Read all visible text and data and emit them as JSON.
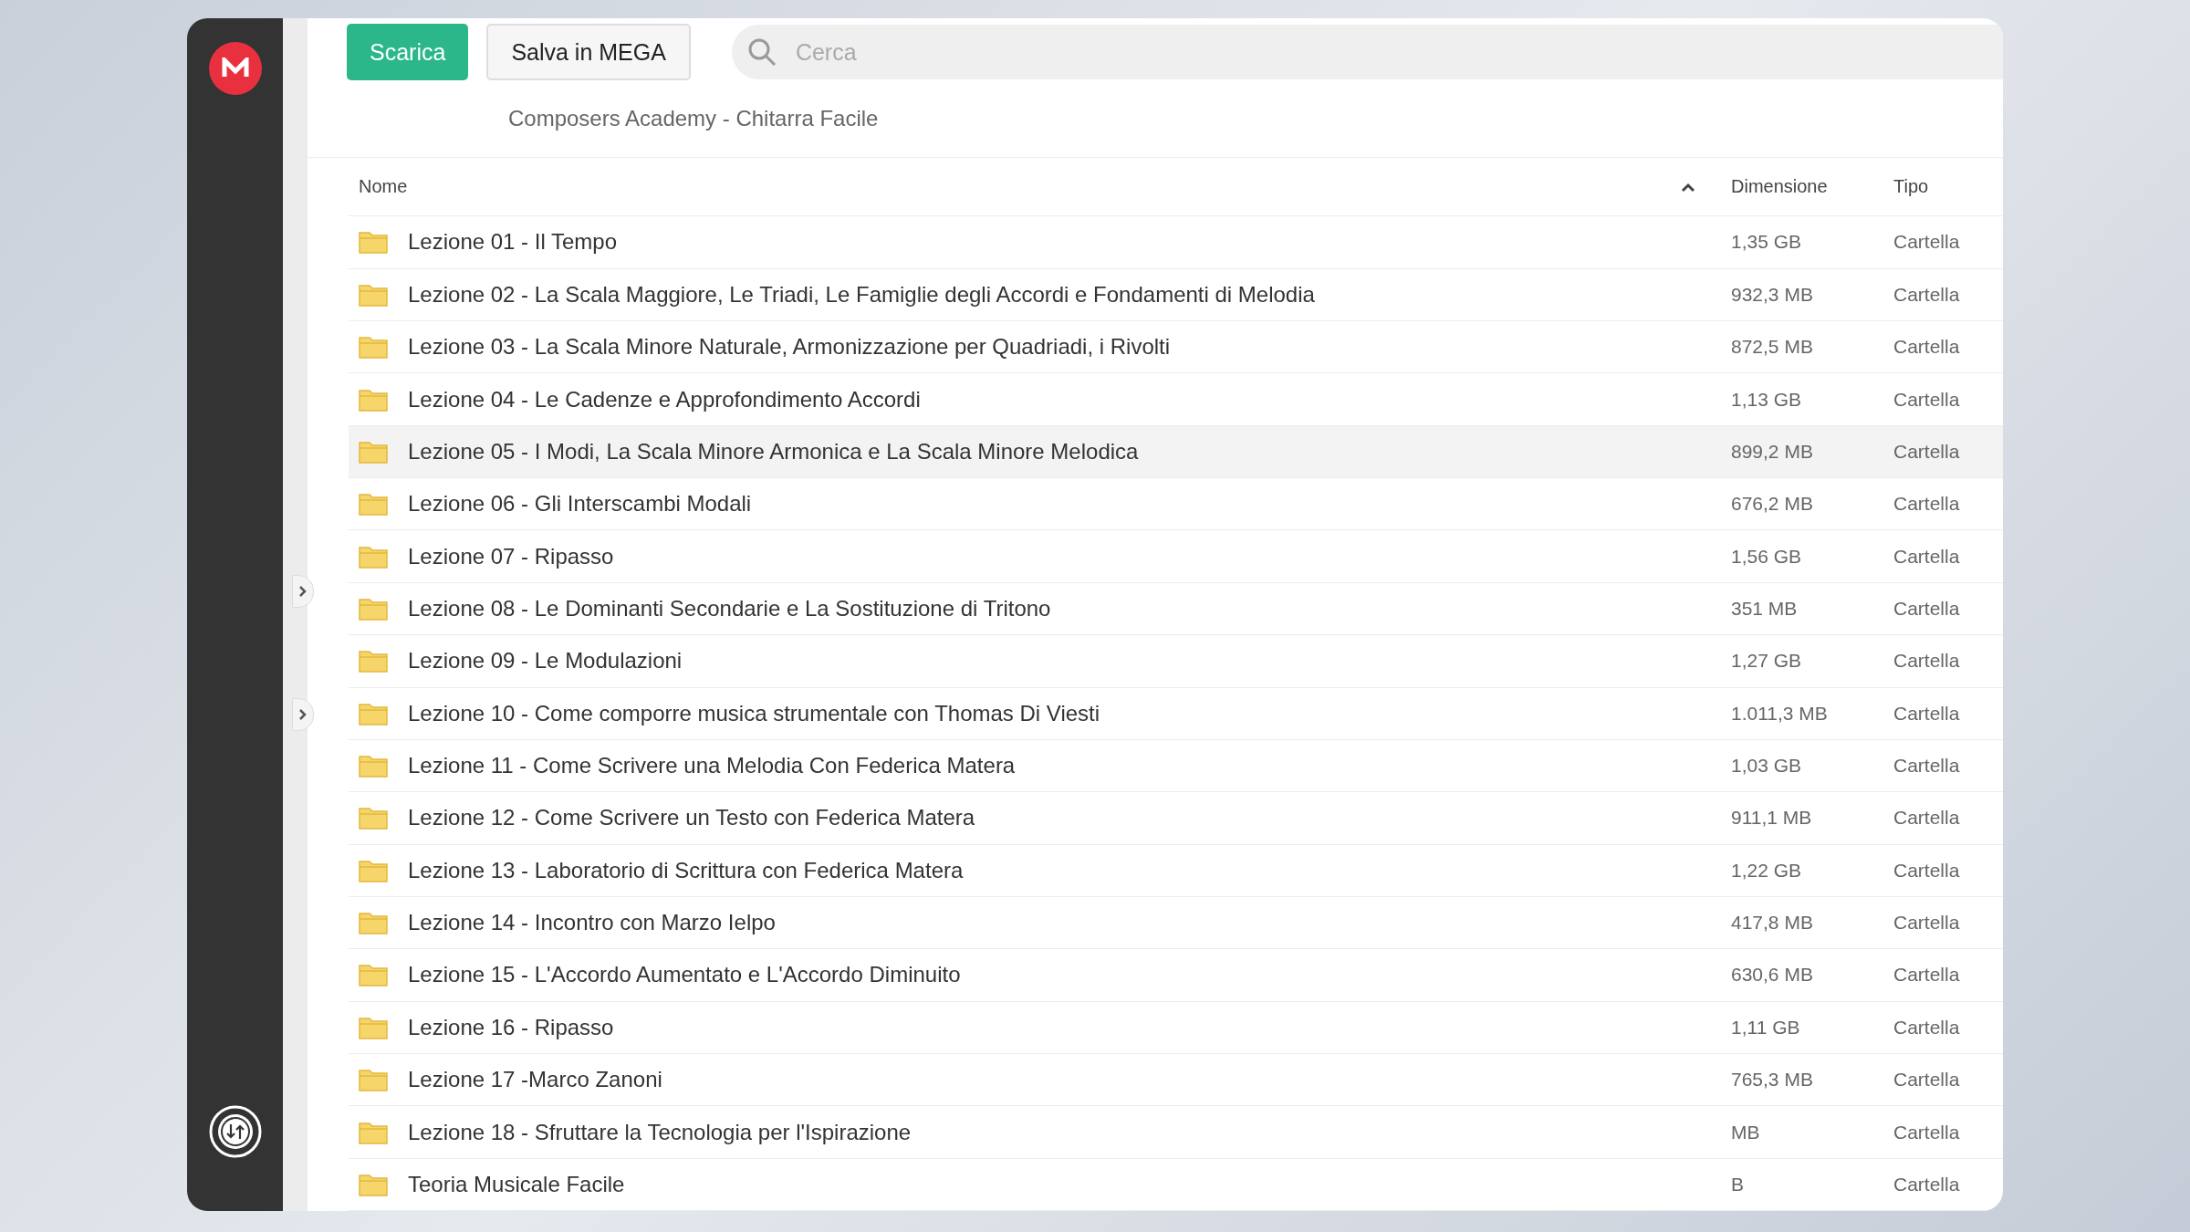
{
  "toolbar": {
    "buttons": [
      {
        "label": "Scarica",
        "kind": "primary"
      },
      {
        "label": "Salva in MEGA",
        "kind": "secondary"
      }
    ],
    "search": {
      "placeholder": "Cerca"
    }
  },
  "breadcrumb": "Composers Academy - Chitarra Facile",
  "table": {
    "columns": [
      "Nome",
      "Dimensione",
      "Tipo"
    ],
    "sort_ascending": true,
    "rows": [
      {
        "name": "Lezione 01 - Il Tempo",
        "size": "1,35 GB",
        "type": "Cartella",
        "selected": false
      },
      {
        "name": "Lezione 02 - La Scala Maggiore, Le Triadi, Le Famiglie degli Accordi e Fondamenti di Melodia",
        "size": "932,3 MB",
        "type": "Cartella",
        "selected": false
      },
      {
        "name": "Lezione 03 - La Scala Minore Naturale, Armonizzazione per Quadriadi, i Rivolti",
        "size": "872,5 MB",
        "type": "Cartella",
        "selected": false
      },
      {
        "name": "Lezione 04 - Le Cadenze e Approfondimento Accordi",
        "size": "1,13 GB",
        "type": "Cartella",
        "selected": false
      },
      {
        "name": "Lezione 05 - I Modi, La Scala Minore Armonica e La Scala Minore Melodica",
        "size": "899,2 MB",
        "type": "Cartella",
        "selected": true
      },
      {
        "name": "Lezione 06 - Gli Interscambi Modali",
        "size": "676,2 MB",
        "type": "Cartella",
        "selected": false
      },
      {
        "name": "Lezione 07 - Ripasso",
        "size": "1,56 GB",
        "type": "Cartella",
        "selected": false
      },
      {
        "name": "Lezione 08 - Le Dominanti Secondarie e La Sostituzione di Tritono",
        "size": "351 MB",
        "type": "Cartella",
        "selected": false
      },
      {
        "name": "Lezione 09 - Le Modulazioni",
        "size": "1,27 GB",
        "type": "Cartella",
        "selected": false
      },
      {
        "name": "Lezione 10 - Come comporre musica strumentale con Thomas Di Viesti",
        "size": "1.011,3 MB",
        "type": "Cartella",
        "selected": false
      },
      {
        "name": "Lezione 11 - Come Scrivere una Melodia Con Federica Matera",
        "size": "1,03 GB",
        "type": "Cartella",
        "selected": false
      },
      {
        "name": "Lezione 12 - Come Scrivere un Testo con Federica Matera",
        "size": "911,1 MB",
        "type": "Cartella",
        "selected": false
      },
      {
        "name": "Lezione 13 - Laboratorio di Scrittura con Federica Matera",
        "size": "1,22 GB",
        "type": "Cartella",
        "selected": false
      },
      {
        "name": "Lezione 14 - Incontro con Marzo Ielpo",
        "size": "417,8 MB",
        "type": "Cartella",
        "selected": false
      },
      {
        "name": "Lezione 15 - L'Accordo Aumentato e L'Accordo Diminuito",
        "size": "630,6 MB",
        "type": "Cartella",
        "selected": false
      },
      {
        "name": "Lezione 16 - Ripasso",
        "size": "1,11 GB",
        "type": "Cartella",
        "selected": false
      },
      {
        "name": "Lezione 17 -Marco Zanoni",
        "size": "765,3 MB",
        "type": "Cartella",
        "selected": false
      },
      {
        "name": "Lezione 18 - Sfruttare la Tecnologia per l'Ispirazione",
        "size": "MB",
        "type": "Cartella",
        "selected": false
      },
      {
        "name": "Teoria Musicale Facile",
        "size": "B",
        "type": "Cartella",
        "selected": false
      }
    ]
  }
}
